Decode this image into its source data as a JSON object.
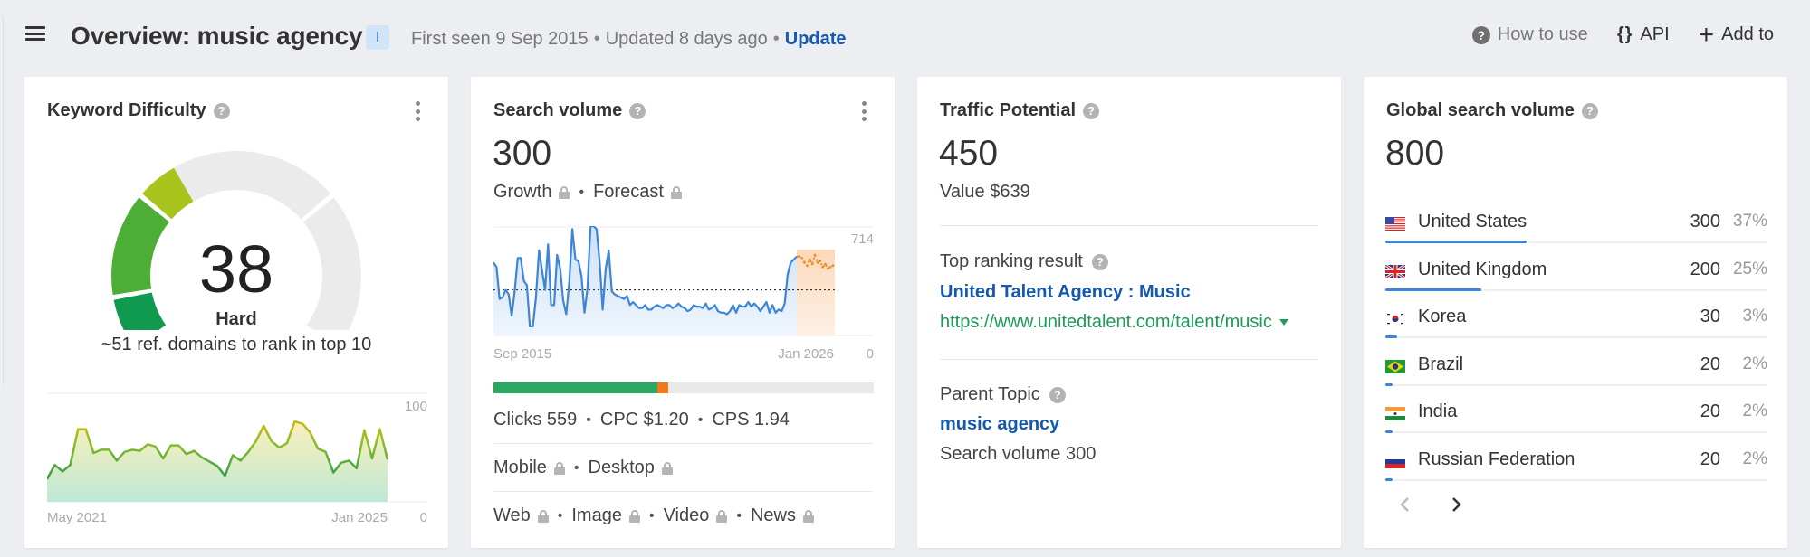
{
  "header": {
    "menu_icon": "hamburger-menu-icon",
    "title": "Overview: music agency",
    "intent_badge": "I",
    "first_seen": "First seen 9 Sep 2015",
    "updated": "Updated 8 days ago",
    "update_link": "Update",
    "separator": "•",
    "actions": [
      {
        "label": "How to use",
        "icon": "help-circle-icon"
      },
      {
        "label": "API",
        "icon": "braces-icon"
      },
      {
        "label": "Add to",
        "icon": "plus-icon"
      }
    ]
  },
  "keyword_difficulty": {
    "title": "Keyword Difficulty",
    "help_icon": "?",
    "value": "38",
    "score": 38,
    "max": 100,
    "label": "Hard",
    "subtitle": "~51 ref. domains to rank in top 10",
    "colors": {
      "seg1": "#0f9a4f",
      "seg2": "#4cae35",
      "seg3": "#a9c41c",
      "empty": "#ebebeb"
    }
  },
  "search_volume": {
    "title": "Search volume",
    "value": "300",
    "growth_label": "Growth",
    "forecast_label": "Forecast",
    "clicks_line": {
      "clicks": "Clicks 559",
      "cpc": "CPC $1.20",
      "cps": "CPS 1.94"
    },
    "clicks_bar": {
      "organic_pct": 43,
      "paid_pct": 3
    },
    "device_line": [
      "Mobile",
      "Desktop"
    ],
    "serp_type_line": [
      "Web",
      "Image",
      "Video",
      "News"
    ]
  },
  "traffic_potential": {
    "title": "Traffic Potential",
    "value": "450",
    "value_text": "Value $639",
    "top_ranking_label": "Top ranking result",
    "top_ranking_title": "United Talent Agency : Music",
    "top_ranking_url": "https://www.unitedtalent.com/talent/music",
    "parent_topic_label": "Parent Topic",
    "parent_topic_link": "music agency",
    "parent_topic_volume": "Search volume 300"
  },
  "global_search_volume": {
    "title": "Global search volume",
    "value": "800",
    "countries": [
      {
        "name": "United States",
        "volume": "300",
        "pct": "37%",
        "share": 37,
        "flag": "us"
      },
      {
        "name": "United Kingdom",
        "volume": "200",
        "pct": "25%",
        "share": 25,
        "flag": "gb"
      },
      {
        "name": "Korea",
        "volume": "30",
        "pct": "3%",
        "share": 3,
        "flag": "kr"
      },
      {
        "name": "Brazil",
        "volume": "20",
        "pct": "2%",
        "share": 2,
        "flag": "br"
      },
      {
        "name": "India",
        "volume": "20",
        "pct": "2%",
        "share": 2,
        "flag": "in"
      },
      {
        "name": "Russian Federation",
        "volume": "20",
        "pct": "2%",
        "share": 2,
        "flag": "ru"
      }
    ],
    "pager": {
      "prev_icon": "chevron-left-icon",
      "next_icon": "chevron-right-icon"
    }
  },
  "chart_data": [
    {
      "type": "area",
      "name": "kd-history",
      "x_start": "May 2021",
      "x_end": "Jan 2025",
      "xlabel": "",
      "ylabel": "",
      "ylim": [
        0,
        100
      ],
      "y_tick_labels": [
        "100",
        "0"
      ],
      "values": [
        21,
        34,
        28,
        34,
        67,
        67,
        45,
        48,
        48,
        38,
        46,
        48,
        47,
        53,
        51,
        40,
        52,
        52,
        44,
        47,
        41,
        37,
        33,
        24,
        43,
        38,
        46,
        56,
        70,
        56,
        50,
        54,
        74,
        72,
        64,
        49,
        46,
        27,
        36,
        38,
        31,
        66,
        40,
        67,
        39
      ]
    },
    {
      "type": "line",
      "name": "search-volume-history",
      "x_start": "Sep 2015",
      "x_end": "Jan 2026",
      "ylim": [
        0,
        714
      ],
      "y_tick_labels": [
        "714",
        "0"
      ],
      "average": 300,
      "series": [
        {
          "name": "history",
          "color": "#3d85d6",
          "values": [
            480,
            450,
            240,
            250,
            300,
            270,
            130,
            290,
            510,
            510,
            360,
            330,
            60,
            60,
            250,
            560,
            430,
            300,
            600,
            200,
            200,
            530,
            440,
            230,
            140,
            360,
            700,
            500,
            490,
            390,
            150,
            310,
            720,
            720,
            700,
            480,
            170,
            440,
            560,
            290,
            270,
            260,
            250,
            240,
            260,
            200,
            220,
            200,
            180,
            180,
            200,
            170,
            170,
            190,
            200,
            190,
            180,
            200,
            200,
            180,
            190,
            210,
            190,
            180,
            160,
            170,
            200,
            190,
            190,
            180,
            210,
            170,
            180,
            200,
            160,
            150,
            150,
            140,
            160,
            200,
            150,
            200,
            190,
            190,
            220,
            190,
            210,
            190,
            160,
            190,
            220,
            150,
            200,
            150,
            170,
            160,
            210,
            400,
            480,
            500,
            520
          ]
        },
        {
          "name": "forecast",
          "color": "#f08a1e",
          "values": [
            520,
            510,
            480,
            460,
            500,
            470,
            530,
            480,
            490,
            450,
            470,
            440,
            450,
            460
          ]
        }
      ]
    }
  ]
}
